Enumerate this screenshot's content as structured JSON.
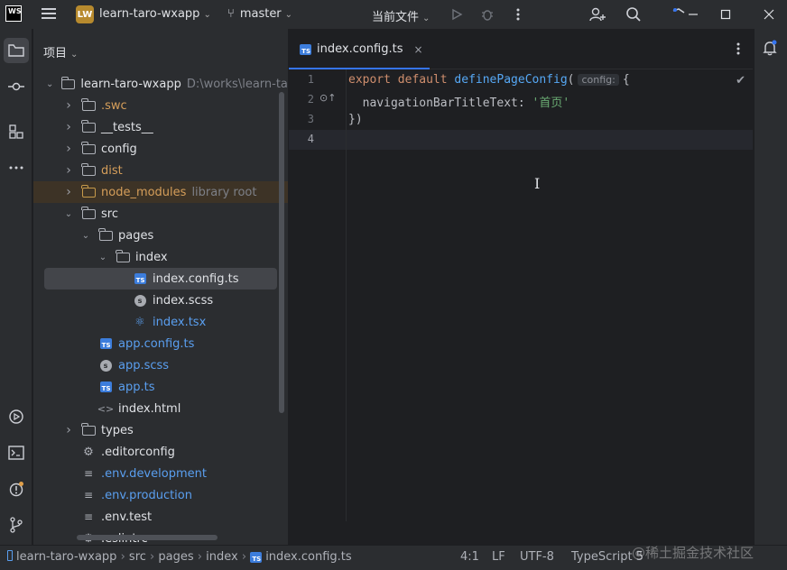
{
  "titlebar": {
    "logo_text": "WS",
    "project_badge": "LW",
    "project_name": "learn-taro-wxapp",
    "branch": "master",
    "run_config": "当前文件"
  },
  "project_panel": {
    "header": "项目",
    "items": [
      {
        "label": "learn-taro-wxapp",
        "suffix": "D:\\works\\learn-tar",
        "indent": 0,
        "arrow": "down",
        "icon": "folder",
        "color": "white"
      },
      {
        "label": ".swc",
        "suffix": "",
        "indent": 1,
        "arrow": "right",
        "icon": "folder",
        "color": "orange"
      },
      {
        "label": "__tests__",
        "suffix": "",
        "indent": 1,
        "arrow": "right",
        "icon": "folder",
        "color": "white"
      },
      {
        "label": "config",
        "suffix": "",
        "indent": 1,
        "arrow": "right",
        "icon": "folder",
        "color": "white"
      },
      {
        "label": "dist",
        "suffix": "",
        "indent": 1,
        "arrow": "right",
        "icon": "folder",
        "color": "orange"
      },
      {
        "label": "node_modules",
        "suffix": "library root",
        "indent": 1,
        "arrow": "right",
        "icon": "folder-orange",
        "color": "orange"
      },
      {
        "label": "src",
        "suffix": "",
        "indent": 1,
        "arrow": "down",
        "icon": "folder",
        "color": "white"
      },
      {
        "label": "pages",
        "suffix": "",
        "indent": 2,
        "arrow": "down",
        "icon": "folder",
        "color": "white"
      },
      {
        "label": "index",
        "suffix": "",
        "indent": 3,
        "arrow": "down",
        "icon": "folder",
        "color": "white"
      },
      {
        "label": "index.config.ts",
        "suffix": "",
        "indent": 4,
        "arrow": "",
        "icon": "ts",
        "color": "white"
      },
      {
        "label": "index.scss",
        "suffix": "",
        "indent": 4,
        "arrow": "",
        "icon": "scss",
        "color": "white"
      },
      {
        "label": "index.tsx",
        "suffix": "",
        "indent": 4,
        "arrow": "",
        "icon": "react",
        "color": "blue"
      },
      {
        "label": "app.config.ts",
        "suffix": "",
        "indent": 2,
        "arrow": "",
        "icon": "ts",
        "color": "blue"
      },
      {
        "label": "app.scss",
        "suffix": "",
        "indent": 2,
        "arrow": "",
        "icon": "scss",
        "color": "blue"
      },
      {
        "label": "app.ts",
        "suffix": "",
        "indent": 2,
        "arrow": "",
        "icon": "ts",
        "color": "blue"
      },
      {
        "label": "index.html",
        "suffix": "",
        "indent": 2,
        "arrow": "",
        "icon": "html",
        "color": "white"
      },
      {
        "label": "types",
        "suffix": "",
        "indent": 1,
        "arrow": "right",
        "icon": "folder",
        "color": "white"
      },
      {
        "label": ".editorconfig",
        "suffix": "",
        "indent": 1,
        "arrow": "",
        "icon": "gear",
        "color": "white"
      },
      {
        "label": ".env.development",
        "suffix": "",
        "indent": 1,
        "arrow": "",
        "icon": "env",
        "color": "blue"
      },
      {
        "label": ".env.production",
        "suffix": "",
        "indent": 1,
        "arrow": "",
        "icon": "env",
        "color": "blue"
      },
      {
        "label": ".env.test",
        "suffix": "",
        "indent": 1,
        "arrow": "",
        "icon": "env",
        "color": "white"
      },
      {
        "label": ".eslintrc",
        "suffix": "",
        "indent": 1,
        "arrow": "",
        "icon": "gear",
        "color": "white"
      }
    ],
    "selected_index": 9,
    "highlighted_index": 5
  },
  "editor": {
    "tab_label": "index.config.ts",
    "tab_close": "×",
    "line_numbers": [
      "1",
      "2",
      "3",
      "4"
    ],
    "current_line": "4",
    "code": {
      "l1_kw1": "export",
      "l1_kw2": "default",
      "l1_fn": "definePageConfig",
      "l1_open": "(",
      "l1_hint": "config:",
      "l1_brace": "{",
      "l2_prop": "navigationBarTitleText",
      "l2_colon": ": ",
      "l2_str": "'首页'",
      "l3": "})"
    }
  },
  "statusbar": {
    "breadcrumbs": [
      "learn-taro-wxapp",
      "src",
      "pages",
      "index",
      "index.config.ts"
    ],
    "position": "4:1",
    "line_ending": "LF",
    "encoding": "UTF-8",
    "language": "TypeScript 5",
    "watermark": "@稀土掘金技术社区"
  }
}
